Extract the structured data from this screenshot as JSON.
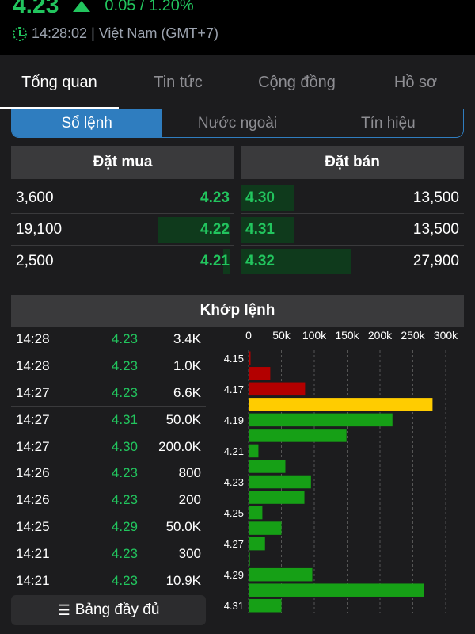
{
  "header": {
    "price": "4.23",
    "change": "0.05 / 1.20%",
    "time": "14:28:02 | Việt Nam (GMT+7)",
    "accent": "#22c55e"
  },
  "tabs": [
    {
      "label": "Tổng quan",
      "active": true
    },
    {
      "label": "Tin tức",
      "active": false
    },
    {
      "label": "Cộng đồng",
      "active": false
    },
    {
      "label": "Hồ sơ",
      "active": false
    }
  ],
  "segments": [
    {
      "label": "Sổ lệnh",
      "active": true
    },
    {
      "label": "Nước ngoài",
      "active": false
    },
    {
      "label": "Tín hiệu",
      "active": false
    }
  ],
  "orderbook": {
    "bid_title": "Đặt mua",
    "ask_title": "Đặt bán",
    "rows": [
      {
        "bid_qty": "3,600",
        "bid_price": "4.23",
        "ask_price": "4.30",
        "ask_qty": "13,500",
        "bid_fill": 0.0,
        "ask_fill": 0.24
      },
      {
        "bid_qty": "19,100",
        "bid_price": "4.22",
        "ask_price": "4.31",
        "ask_qty": "13,500",
        "bid_fill": 0.36,
        "ask_fill": 0.24
      },
      {
        "bid_qty": "2,500",
        "bid_price": "4.21",
        "ask_price": "4.32",
        "ask_qty": "27,900",
        "bid_fill": 0.03,
        "ask_fill": 0.5
      }
    ]
  },
  "matching": {
    "title": "Khớp lệnh",
    "trades": [
      {
        "time": "14:28",
        "price": "4.23",
        "volume": "3.4K"
      },
      {
        "time": "14:28",
        "price": "4.23",
        "volume": "1.0K"
      },
      {
        "time": "14:27",
        "price": "4.23",
        "volume": "6.6K"
      },
      {
        "time": "14:27",
        "price": "4.31",
        "volume": "50.0K"
      },
      {
        "time": "14:27",
        "price": "4.30",
        "volume": "200.0K"
      },
      {
        "time": "14:26",
        "price": "4.23",
        "volume": "800"
      },
      {
        "time": "14:26",
        "price": "4.23",
        "volume": "200"
      },
      {
        "time": "14:25",
        "price": "4.29",
        "volume": "50.0K"
      },
      {
        "time": "14:21",
        "price": "4.23",
        "volume": "300"
      },
      {
        "time": "14:21",
        "price": "4.23",
        "volume": "10.9K"
      }
    ],
    "full_button": "Bảng đầy đủ"
  },
  "chart_data": {
    "type": "bar",
    "orientation": "horizontal",
    "x_ticks": [
      "0",
      "50k",
      "100k",
      "150k",
      "200k",
      "250k",
      "300k"
    ],
    "xlim": [
      0,
      300000
    ],
    "y_tick_labels": [
      "4.15",
      "4.17",
      "4.19",
      "4.21",
      "4.23",
      "4.25",
      "4.27",
      "4.29",
      "4.31"
    ],
    "categories": [
      "4.15",
      "4.16",
      "4.17",
      "4.18",
      "4.19",
      "4.20",
      "4.21",
      "4.22",
      "4.23",
      "4.24",
      "4.25",
      "4.26",
      "4.27",
      "4.28",
      "4.29",
      "4.30",
      "4.31"
    ],
    "values": [
      3000,
      33000,
      86000,
      280000,
      219000,
      149000,
      15000,
      56000,
      95000,
      85000,
      21000,
      50000,
      25000,
      2000,
      97000,
      267000,
      50000
    ],
    "colors": [
      "#b30000",
      "#b30000",
      "#b30000",
      "#ffcc00",
      "#16a016",
      "#16a016",
      "#16a016",
      "#16a016",
      "#16a016",
      "#16a016",
      "#16a016",
      "#16a016",
      "#16a016",
      "#16a016",
      "#16a016",
      "#16a016",
      "#16a016"
    ],
    "grid": true
  }
}
